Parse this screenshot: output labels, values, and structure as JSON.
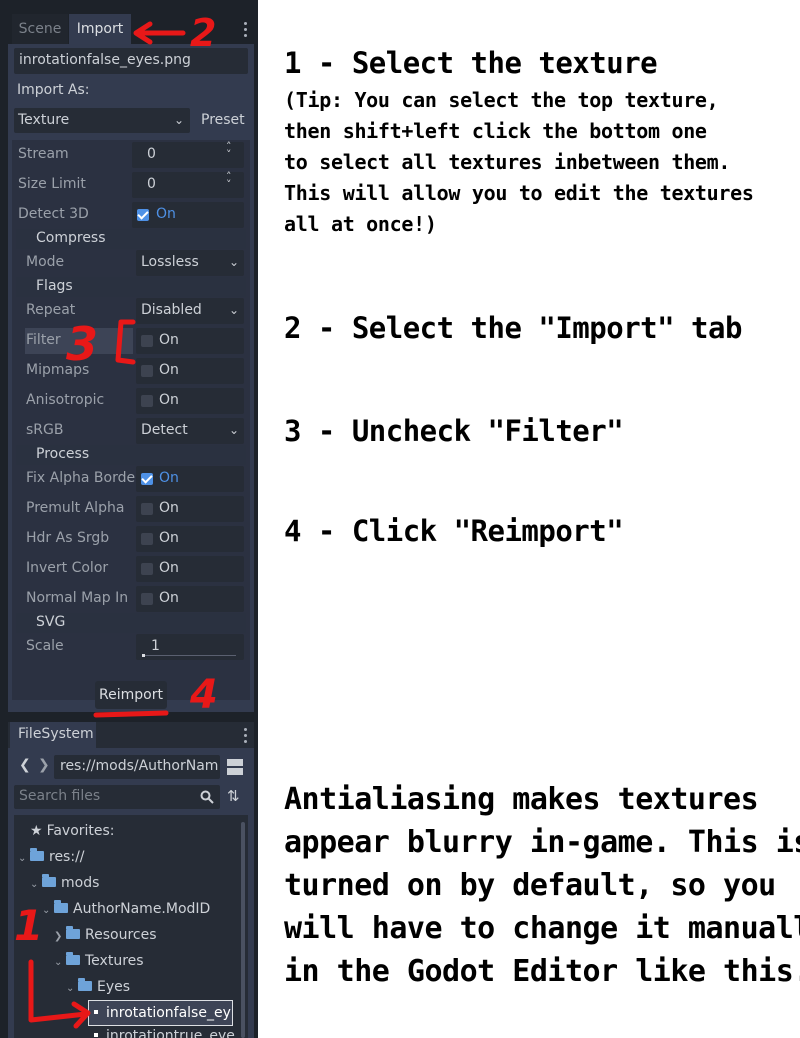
{
  "tabs": {
    "scene": "Scene",
    "import": "Import"
  },
  "import_panel": {
    "file_name": "inrotationfalse_eyes.png",
    "import_as_label": "Import As:",
    "import_as_value": "Texture",
    "preset_label": "Preset",
    "properties": {
      "stream": {
        "label": "Stream",
        "value": "0"
      },
      "size_limit": {
        "label": "Size Limit",
        "value": "0"
      },
      "detect_3d": {
        "label": "Detect 3D",
        "value": "On",
        "checked": true
      },
      "compress_section": "Compress",
      "mode": {
        "label": "Mode",
        "value": "Lossless"
      },
      "flags_section": "Flags",
      "repeat": {
        "label": "Repeat",
        "value": "Disabled"
      },
      "filter": {
        "label": "Filter",
        "value": "On",
        "checked": false
      },
      "mipmaps": {
        "label": "Mipmaps",
        "value": "On",
        "checked": false
      },
      "anisotropic": {
        "label": "Anisotropic",
        "value": "On",
        "checked": false
      },
      "srgb": {
        "label": "sRGB",
        "value": "Detect"
      },
      "process_section": "Process",
      "fix_alpha_border": {
        "label": "Fix Alpha Borde",
        "value": "On",
        "checked": true
      },
      "premult_alpha": {
        "label": "Premult Alpha",
        "value": "On",
        "checked": false
      },
      "hdr_as_srgb": {
        "label": "Hdr As Srgb",
        "value": "On",
        "checked": false
      },
      "invert_color": {
        "label": "Invert Color",
        "value": "On",
        "checked": false
      },
      "normal_map_invert": {
        "label": "Normal Map In",
        "value": "On",
        "checked": false
      },
      "svg_section": "SVG",
      "scale": {
        "label": "Scale",
        "value": "1"
      }
    },
    "reimport_label": "Reimport"
  },
  "filesystem": {
    "title": "FileSystem",
    "path": "res://mods/AuthorNam",
    "search_placeholder": "Search files",
    "tree": {
      "favorites": "Favorites:",
      "res": "res://",
      "mods": "mods",
      "author": "AuthorName.ModID",
      "resources": "Resources",
      "textures": "Textures",
      "eyes": "Eyes",
      "file1": "inrotationfalse_ey",
      "file2": "inrotationtrue_eye"
    }
  },
  "annotations": {
    "n1": "1",
    "n2": "2",
    "n3": "3",
    "n4": "4"
  },
  "instructions": {
    "step1": "1 - Select the texture",
    "tip": [
      "(Tip: You can select the top texture,",
      "then shift+left click the bottom one",
      "to select all textures inbetween them.",
      "This will allow you to edit the textures",
      "all at once!)"
    ],
    "step2": "2 - Select the \"Import\" tab",
    "step3": "3 - Uncheck \"Filter\"",
    "step4": "4 - Click \"Reimport\"",
    "explanation": [
      "Antialiasing makes textures",
      "appear blurry in-game. This is",
      "turned on by default, so you",
      "will have to change it manually",
      "in the Godot Editor like this."
    ]
  },
  "colors": {
    "accent": "#4e91e6",
    "annotation_red": "#e81818",
    "panel_bg": "#333b4f",
    "editor_bg": "#1d2229"
  },
  "icons": [
    "more-options-icon",
    "chevron-down-icon",
    "spinner-arrows-icon",
    "checkbox-icon",
    "star-icon",
    "folder-icon",
    "search-icon",
    "sort-icon",
    "split-view-icon",
    "back-icon",
    "forward-icon",
    "file-icon"
  ]
}
